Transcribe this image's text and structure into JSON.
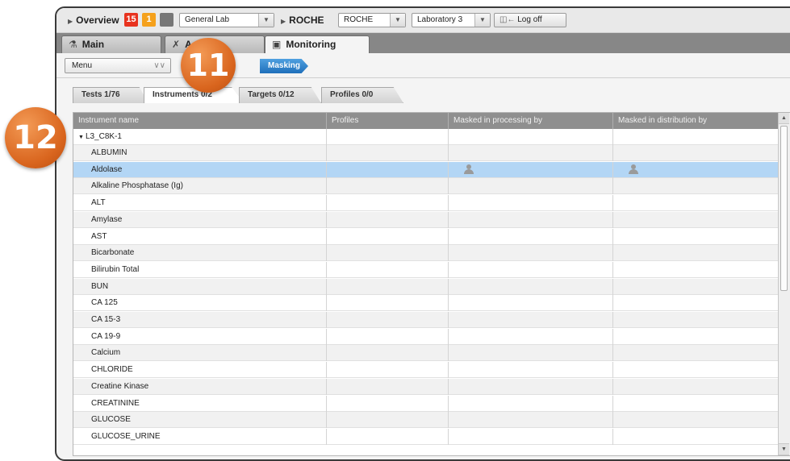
{
  "topbar": {
    "overview_label": "Overview",
    "badge_red": "15",
    "badge_orange": "1",
    "lab_select": "General Lab",
    "roche_label": "ROCHE",
    "roche_select": "ROCHE",
    "laboratory_select": "Laboratory 3",
    "logoff_label": "Log off"
  },
  "tabs": [
    {
      "label": "Main",
      "icon": "flask-icon"
    },
    {
      "label": "A",
      "icon": "tools-icon"
    },
    {
      "label": "Monitoring",
      "icon": "monitor-icon"
    }
  ],
  "toolbar": {
    "menu_label": "Menu",
    "masking_label": "Masking"
  },
  "subtabs": [
    "Tests 1/76",
    "Instruments 0/2",
    "Targets 0/12",
    "Profiles 0/0"
  ],
  "table": {
    "columns": [
      "Instrument name",
      "Profiles",
      "Masked in processing by",
      "Masked in distribution by"
    ],
    "group": "L3_C8K-1",
    "rows": [
      "ALBUMIN",
      "Aldolase",
      "Alkaline Phosphatase (Ig)",
      "ALT",
      "Amylase",
      "AST",
      "Bicarbonate",
      "Bilirubin Total",
      "BUN",
      "CA 125",
      "CA 15-3",
      "CA 19-9",
      "Calcium",
      "CHLORIDE",
      "Creatine Kinase",
      "CREATININE",
      "GLUCOSE",
      "GLUCOSE_URINE"
    ],
    "selected_row": "Aldolase"
  },
  "callouts": [
    "11",
    "12"
  ],
  "colors": {
    "badge_red": "#e8331f",
    "badge_orange": "#f5a11c",
    "masking_blue": "#2a7fcb",
    "selected_row": "#b3d6f5",
    "callout_orange": "#e0742b"
  }
}
